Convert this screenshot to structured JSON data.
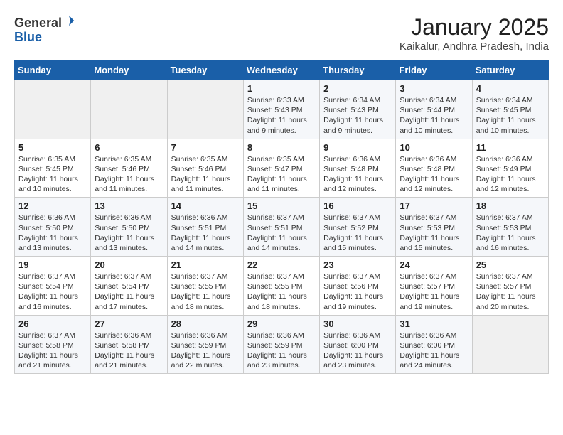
{
  "header": {
    "logo_line1": "General",
    "logo_line2": "Blue",
    "month_title": "January 2025",
    "location": "Kaikalur, Andhra Pradesh, India"
  },
  "weekdays": [
    "Sunday",
    "Monday",
    "Tuesday",
    "Wednesday",
    "Thursday",
    "Friday",
    "Saturday"
  ],
  "weeks": [
    [
      {
        "day": "",
        "info": ""
      },
      {
        "day": "",
        "info": ""
      },
      {
        "day": "",
        "info": ""
      },
      {
        "day": "1",
        "info": "Sunrise: 6:33 AM\nSunset: 5:43 PM\nDaylight: 11 hours\nand 9 minutes."
      },
      {
        "day": "2",
        "info": "Sunrise: 6:34 AM\nSunset: 5:43 PM\nDaylight: 11 hours\nand 9 minutes."
      },
      {
        "day": "3",
        "info": "Sunrise: 6:34 AM\nSunset: 5:44 PM\nDaylight: 11 hours\nand 10 minutes."
      },
      {
        "day": "4",
        "info": "Sunrise: 6:34 AM\nSunset: 5:45 PM\nDaylight: 11 hours\nand 10 minutes."
      }
    ],
    [
      {
        "day": "5",
        "info": "Sunrise: 6:35 AM\nSunset: 5:45 PM\nDaylight: 11 hours\nand 10 minutes."
      },
      {
        "day": "6",
        "info": "Sunrise: 6:35 AM\nSunset: 5:46 PM\nDaylight: 11 hours\nand 11 minutes."
      },
      {
        "day": "7",
        "info": "Sunrise: 6:35 AM\nSunset: 5:46 PM\nDaylight: 11 hours\nand 11 minutes."
      },
      {
        "day": "8",
        "info": "Sunrise: 6:35 AM\nSunset: 5:47 PM\nDaylight: 11 hours\nand 11 minutes."
      },
      {
        "day": "9",
        "info": "Sunrise: 6:36 AM\nSunset: 5:48 PM\nDaylight: 11 hours\nand 12 minutes."
      },
      {
        "day": "10",
        "info": "Sunrise: 6:36 AM\nSunset: 5:48 PM\nDaylight: 11 hours\nand 12 minutes."
      },
      {
        "day": "11",
        "info": "Sunrise: 6:36 AM\nSunset: 5:49 PM\nDaylight: 11 hours\nand 12 minutes."
      }
    ],
    [
      {
        "day": "12",
        "info": "Sunrise: 6:36 AM\nSunset: 5:50 PM\nDaylight: 11 hours\nand 13 minutes."
      },
      {
        "day": "13",
        "info": "Sunrise: 6:36 AM\nSunset: 5:50 PM\nDaylight: 11 hours\nand 13 minutes."
      },
      {
        "day": "14",
        "info": "Sunrise: 6:36 AM\nSunset: 5:51 PM\nDaylight: 11 hours\nand 14 minutes."
      },
      {
        "day": "15",
        "info": "Sunrise: 6:37 AM\nSunset: 5:51 PM\nDaylight: 11 hours\nand 14 minutes."
      },
      {
        "day": "16",
        "info": "Sunrise: 6:37 AM\nSunset: 5:52 PM\nDaylight: 11 hours\nand 15 minutes."
      },
      {
        "day": "17",
        "info": "Sunrise: 6:37 AM\nSunset: 5:53 PM\nDaylight: 11 hours\nand 15 minutes."
      },
      {
        "day": "18",
        "info": "Sunrise: 6:37 AM\nSunset: 5:53 PM\nDaylight: 11 hours\nand 16 minutes."
      }
    ],
    [
      {
        "day": "19",
        "info": "Sunrise: 6:37 AM\nSunset: 5:54 PM\nDaylight: 11 hours\nand 16 minutes."
      },
      {
        "day": "20",
        "info": "Sunrise: 6:37 AM\nSunset: 5:54 PM\nDaylight: 11 hours\nand 17 minutes."
      },
      {
        "day": "21",
        "info": "Sunrise: 6:37 AM\nSunset: 5:55 PM\nDaylight: 11 hours\nand 18 minutes."
      },
      {
        "day": "22",
        "info": "Sunrise: 6:37 AM\nSunset: 5:55 PM\nDaylight: 11 hours\nand 18 minutes."
      },
      {
        "day": "23",
        "info": "Sunrise: 6:37 AM\nSunset: 5:56 PM\nDaylight: 11 hours\nand 19 minutes."
      },
      {
        "day": "24",
        "info": "Sunrise: 6:37 AM\nSunset: 5:57 PM\nDaylight: 11 hours\nand 19 minutes."
      },
      {
        "day": "25",
        "info": "Sunrise: 6:37 AM\nSunset: 5:57 PM\nDaylight: 11 hours\nand 20 minutes."
      }
    ],
    [
      {
        "day": "26",
        "info": "Sunrise: 6:37 AM\nSunset: 5:58 PM\nDaylight: 11 hours\nand 21 minutes."
      },
      {
        "day": "27",
        "info": "Sunrise: 6:36 AM\nSunset: 5:58 PM\nDaylight: 11 hours\nand 21 minutes."
      },
      {
        "day": "28",
        "info": "Sunrise: 6:36 AM\nSunset: 5:59 PM\nDaylight: 11 hours\nand 22 minutes."
      },
      {
        "day": "29",
        "info": "Sunrise: 6:36 AM\nSunset: 5:59 PM\nDaylight: 11 hours\nand 23 minutes."
      },
      {
        "day": "30",
        "info": "Sunrise: 6:36 AM\nSunset: 6:00 PM\nDaylight: 11 hours\nand 23 minutes."
      },
      {
        "day": "31",
        "info": "Sunrise: 6:36 AM\nSunset: 6:00 PM\nDaylight: 11 hours\nand 24 minutes."
      },
      {
        "day": "",
        "info": ""
      }
    ]
  ]
}
